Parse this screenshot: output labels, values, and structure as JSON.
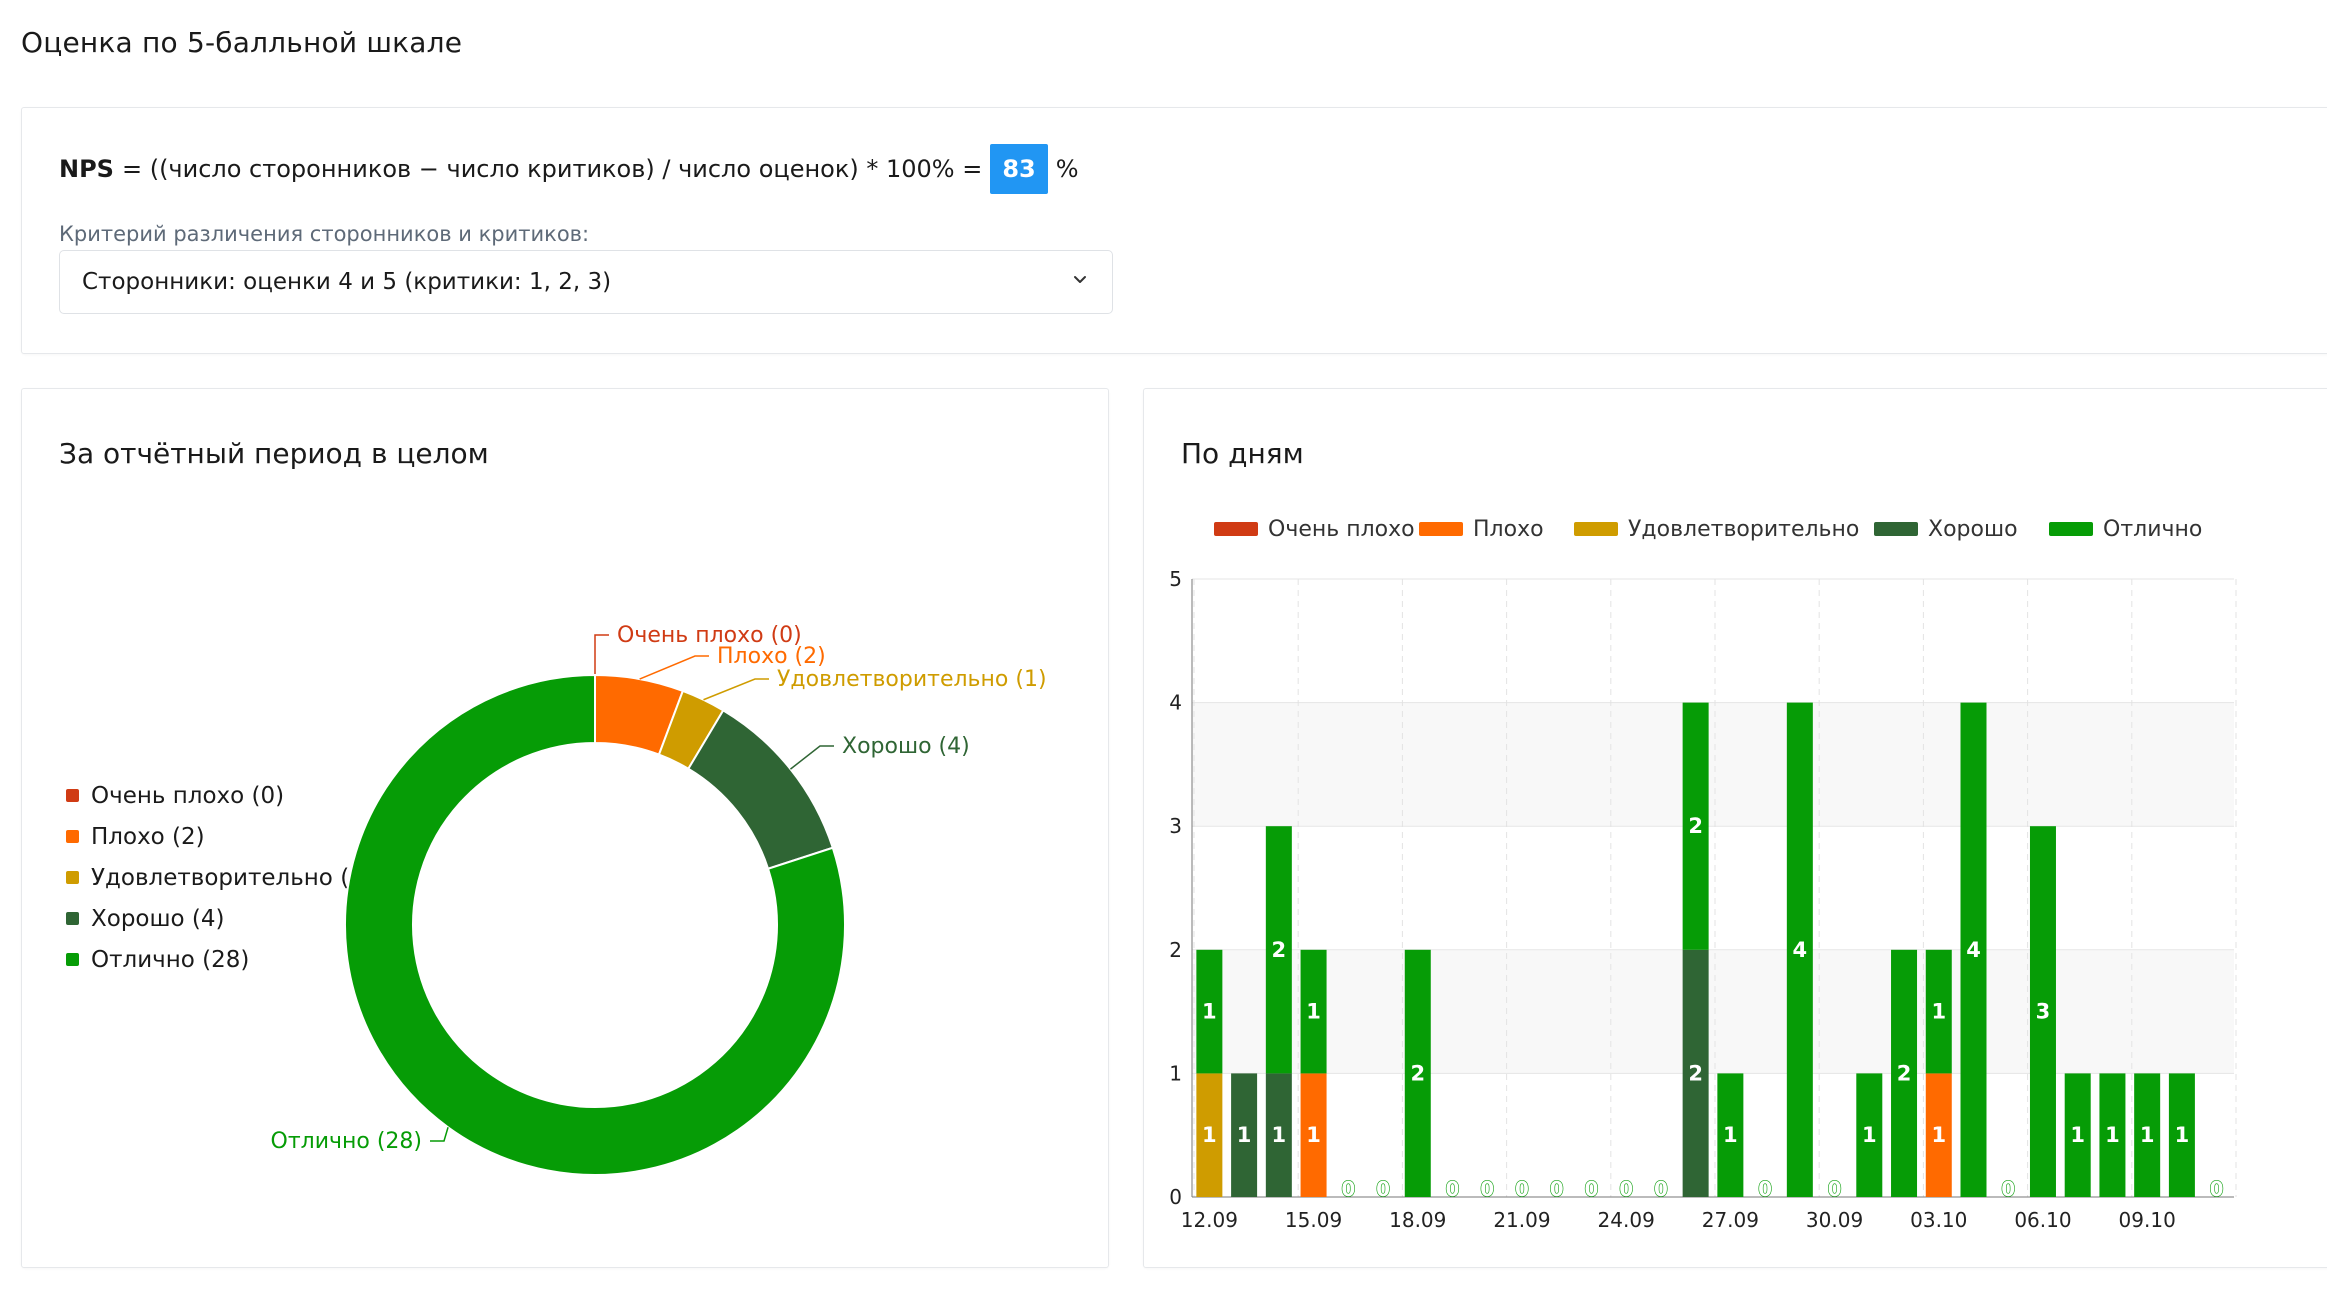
{
  "page_title": "Оценка по 5-балльной шкале",
  "nps": {
    "label": "NPS",
    "formula_text": "= ((число сторонников − число критиков) / число оценок) * 100% =",
    "value": "83",
    "unit": "%",
    "criteria_label": "Критерий различения сторонников и критиков:",
    "criteria_selected": "Сторонники: оценки 4 и 5 (критики: 1, 2, 3)"
  },
  "colors": {
    "very_bad": "#d03b14",
    "bad": "#ff6a00",
    "satisfactory": "#cf9c00",
    "good": "#2f6534",
    "excellent": "#069c06",
    "badge": "#2196f3"
  },
  "chart_data": [
    {
      "type": "pie",
      "title": "За отчётный период в целом",
      "labels": [
        "Очень плохо",
        "Плохо",
        "Удовлетворительно",
        "Хорошо",
        "Отлично"
      ],
      "values": [
        0,
        2,
        1,
        4,
        28
      ],
      "legend_items": [
        "Очень плохо (0)",
        "Плохо (2)",
        "Удовлетворительно (1)",
        "Хорошо (4)",
        "Отлично (28)"
      ],
      "colors": [
        "#d03b14",
        "#ff6a00",
        "#cf9c00",
        "#2f6534",
        "#069c06"
      ],
      "legend": "left",
      "donut": true
    },
    {
      "type": "bar",
      "stacked": true,
      "title": "По дням",
      "legend": "top",
      "x_tick_labels": [
        "12.09",
        "15.09",
        "18.09",
        "21.09",
        "24.09",
        "27.09",
        "30.09",
        "03.10",
        "06.10",
        "09.10"
      ],
      "ylim": [
        0,
        5
      ],
      "yticks": [
        0,
        1,
        2,
        3,
        4,
        5
      ],
      "days": 30,
      "series": [
        {
          "name": "Очень плохо",
          "color": "#d03b14",
          "values": [
            0,
            0,
            0,
            0,
            0,
            0,
            0,
            0,
            0,
            0,
            0,
            0,
            0,
            0,
            0,
            0,
            0,
            0,
            0,
            0,
            0,
            0,
            0,
            0,
            0,
            0,
            0,
            0,
            0,
            0
          ]
        },
        {
          "name": "Плохо",
          "color": "#ff6a00",
          "values": [
            0,
            0,
            0,
            1,
            0,
            0,
            0,
            0,
            0,
            0,
            0,
            0,
            0,
            0,
            0,
            0,
            0,
            0,
            0,
            0,
            0,
            1,
            0,
            0,
            0,
            0,
            0,
            0,
            0,
            0
          ]
        },
        {
          "name": "Удовлетворительно",
          "color": "#cf9c00",
          "values": [
            1,
            0,
            0,
            0,
            0,
            0,
            0,
            0,
            0,
            0,
            0,
            0,
            0,
            0,
            0,
            0,
            0,
            0,
            0,
            0,
            0,
            0,
            0,
            0,
            0,
            0,
            0,
            0,
            0,
            0
          ]
        },
        {
          "name": "Хорошо",
          "color": "#2f6534",
          "values": [
            0,
            1,
            1,
            0,
            0,
            0,
            0,
            0,
            0,
            0,
            0,
            0,
            0,
            0,
            2,
            0,
            0,
            0,
            0,
            0,
            0,
            0,
            0,
            0,
            0,
            0,
            0,
            0,
            0,
            0
          ]
        },
        {
          "name": "Отлично",
          "color": "#069c06",
          "values": [
            1,
            0,
            2,
            1,
            0,
            0,
            2,
            0,
            0,
            0,
            0,
            0,
            0,
            0,
            2,
            1,
            0,
            4,
            0,
            1,
            2,
            1,
            4,
            0,
            3,
            1,
            1,
            1,
            1,
            0
          ]
        }
      ]
    }
  ]
}
